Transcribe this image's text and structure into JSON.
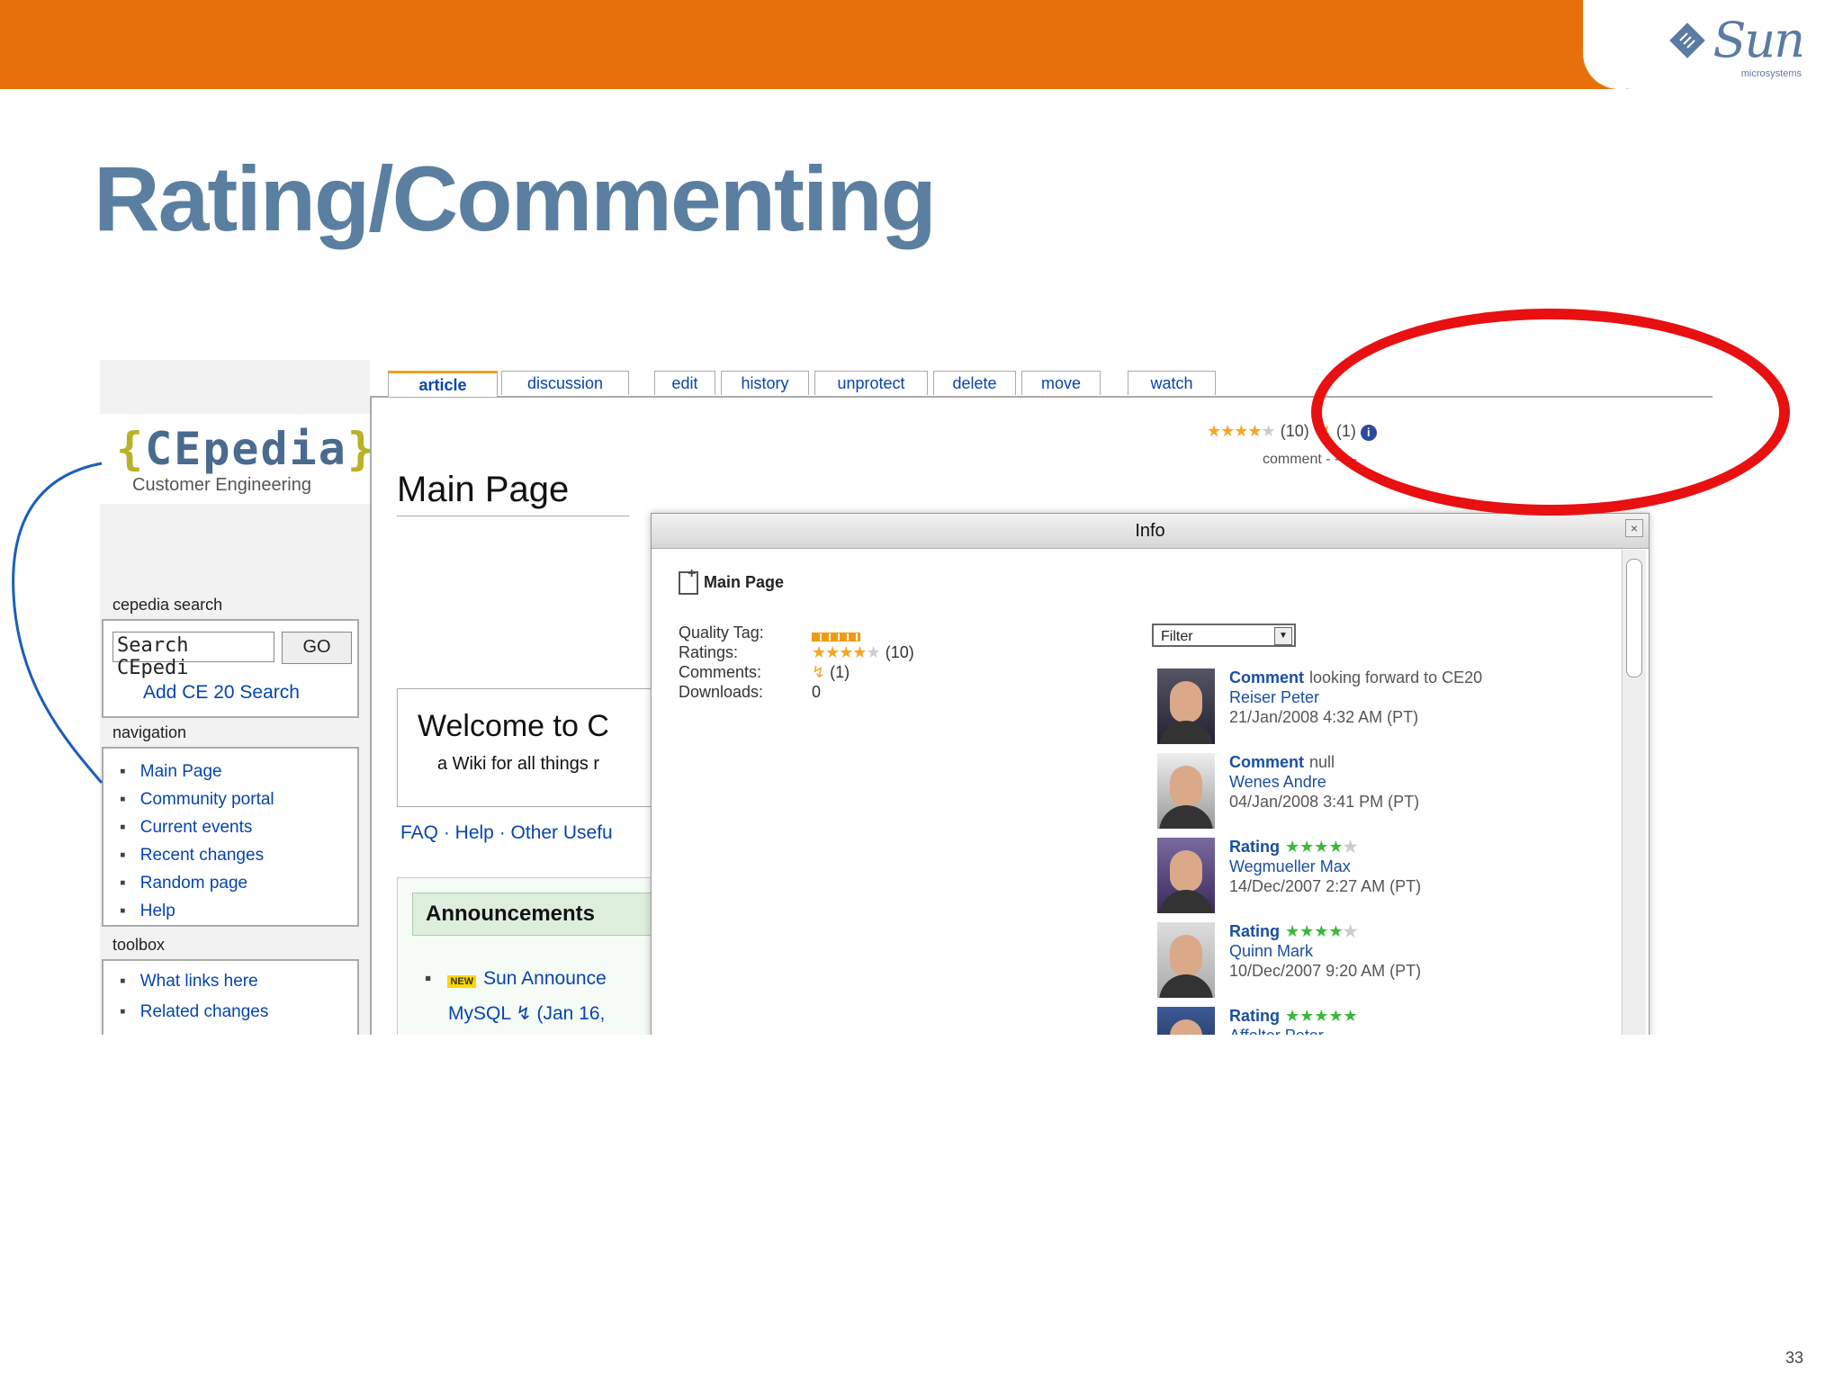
{
  "slide": {
    "title": "Rating/Commenting",
    "page_number": "33",
    "logo_text": "Sun",
    "logo_sub": "microsystems"
  },
  "colors": {
    "orange_bar": "#e8700a",
    "title_blue": "#5b7fa0",
    "highlight_red": "#e81010",
    "link_blue": "#0645ad"
  },
  "wiki": {
    "site_name": "CEpedia",
    "site_subtitle": "Customer Engineering",
    "search_heading": "cepedia search",
    "search_value": "Search CEpedi",
    "go_label": "GO",
    "add_search": "Add CE 20 Search",
    "nav_heading": "navigation",
    "nav_items": [
      "Main Page",
      "Community portal",
      "Current events",
      "Recent changes",
      "Random page",
      "Help"
    ],
    "toolbox_heading": "toolbox",
    "toolbox_items": [
      "What links here",
      "Related changes"
    ],
    "tabs": [
      "article",
      "discussion",
      "edit",
      "history",
      "unprotect",
      "delete",
      "move",
      "watch"
    ],
    "page_heading": "Main Page",
    "welcome_title": "Welcome to C",
    "welcome_sub": "a Wiki for all things r",
    "faq_links": "FAQ · Help · Other Usefu",
    "announcements": "Announcements",
    "ann_new": "NEW",
    "ann_item": "Sun Announce",
    "ann_sub": "MySQL ↯ (Jan 16,",
    "rating_stars": "★★★★",
    "rating_star_empty": "★",
    "rating_count": "(10)",
    "comment_icon": "↯",
    "comment_count": "(1)",
    "info_icon": "i",
    "comment_link": "comment - - - -"
  },
  "info_dialog": {
    "title": "Info",
    "close": "×",
    "page": "Main Page",
    "labels": [
      "Quality Tag:",
      "Ratings:",
      "Comments:",
      "Downloads:"
    ],
    "ratings_stars": "★★★★",
    "ratings_empty": "★",
    "ratings_count": "(10)",
    "comments_icon": "↯",
    "comments_count": "(1)",
    "downloads": "0",
    "filter_label": "Filter",
    "filter_arrow": "▼",
    "feed": [
      {
        "type": "Comment",
        "stars": "",
        "text": "looking forward to CE20",
        "name": "Reiser Peter",
        "date": "21/Jan/2008 4:32 AM (PT)"
      },
      {
        "type": "Comment",
        "stars": "",
        "text": "null",
        "name": "Wenes Andre",
        "date": "04/Jan/2008 3:41 PM (PT)"
      },
      {
        "type": "Rating",
        "stars": "★★★★",
        "text": "",
        "name": "Wegmueller Max",
        "date": "14/Dec/2007 2:27 AM (PT)"
      },
      {
        "type": "Rating",
        "stars": "★★★★",
        "text": "",
        "name": "Quinn Mark",
        "date": "10/Dec/2007 9:20 AM (PT)"
      },
      {
        "type": "Rating",
        "stars": "★★★★★",
        "text": "",
        "name": "Affolter Peter",
        "date": ""
      }
    ]
  }
}
